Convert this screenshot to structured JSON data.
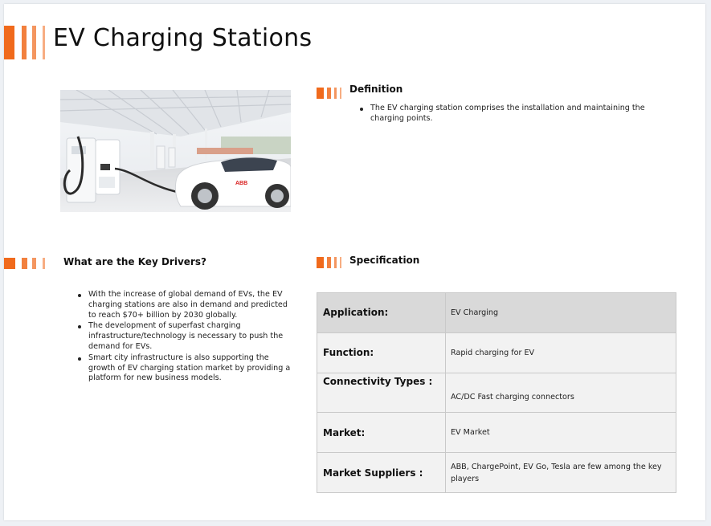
{
  "title": "EV Charging Stations",
  "accent_color": "#f06a1c",
  "definition": {
    "heading": "Definition",
    "items": [
      "The EV charging station comprises the installation and maintaining the charging points."
    ]
  },
  "drivers": {
    "heading": "What are the Key Drivers?",
    "items": [
      "With the increase of global demand of EVs, the EV charging stations are also in demand and predicted to reach $70+ billion by 2030 globally.",
      "The development of superfast charging infrastructure/technology is necessary to push the demand for EVs.",
      "Smart city infrastructure is also supporting the growth of EV charging station market by providing a platform for new business models."
    ]
  },
  "specification": {
    "heading": "Specification",
    "rows": [
      {
        "key": "Application:",
        "value": "EV Charging"
      },
      {
        "key": "Function:",
        "value": "Rapid charging for EV"
      },
      {
        "key": "Connectivity Types :",
        "value": "AC/DC Fast charging connectors"
      },
      {
        "key": "Market:",
        "value": "EV Market"
      },
      {
        "key": "Market Suppliers :",
        "value": "ABB, ChargePoint, EV Go, Tesla are few among the key players"
      }
    ]
  },
  "photo": {
    "car_badge": "ABB"
  }
}
